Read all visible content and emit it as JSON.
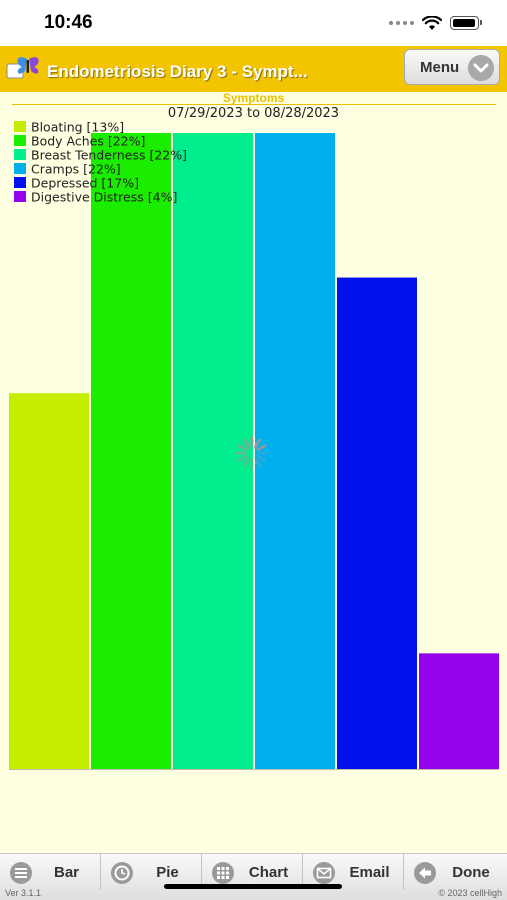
{
  "status_bar": {
    "time": "10:46"
  },
  "header": {
    "title": "Endometriosis Diary 3 - Sympt...",
    "menu_label": "Menu",
    "brand_color": "#f2c500"
  },
  "chart_header": {
    "section": "Symptoms",
    "range": "07/29/2023 to 08/28/2023"
  },
  "chart_data": {
    "type": "bar",
    "categories": [
      "Bloating",
      "Body Aches",
      "Breast Tenderness",
      "Cramps",
      "Depressed",
      "Digestive Distress"
    ],
    "values": [
      13,
      22,
      22,
      22,
      17,
      4
    ],
    "legend": [
      "Bloating [13%]",
      "Body Aches [22%]",
      "Breast Tenderness [22%]",
      "Cramps [22%]",
      "Depressed [17%]",
      "Digestive Distress [4%]"
    ],
    "colors": [
      "#c4ed00",
      "#1aed00",
      "#00ed8e",
      "#00b0ed",
      "#0011ed",
      "#9500ed"
    ],
    "ylim": [
      0,
      22
    ],
    "legend_position": "top-left",
    "grid": false
  },
  "bottom_bar": {
    "tabs": [
      {
        "label": "Bar",
        "icon": "list-icon"
      },
      {
        "label": "Pie",
        "icon": "clock-icon"
      },
      {
        "label": "Chart",
        "icon": "grid-icon"
      },
      {
        "label": "Email",
        "icon": "envelope-icon"
      },
      {
        "label": "Done",
        "icon": "back-arrow-icon"
      }
    ],
    "version": "Ver 3.1.1",
    "copyright": "© 2023 cellHigh"
  }
}
